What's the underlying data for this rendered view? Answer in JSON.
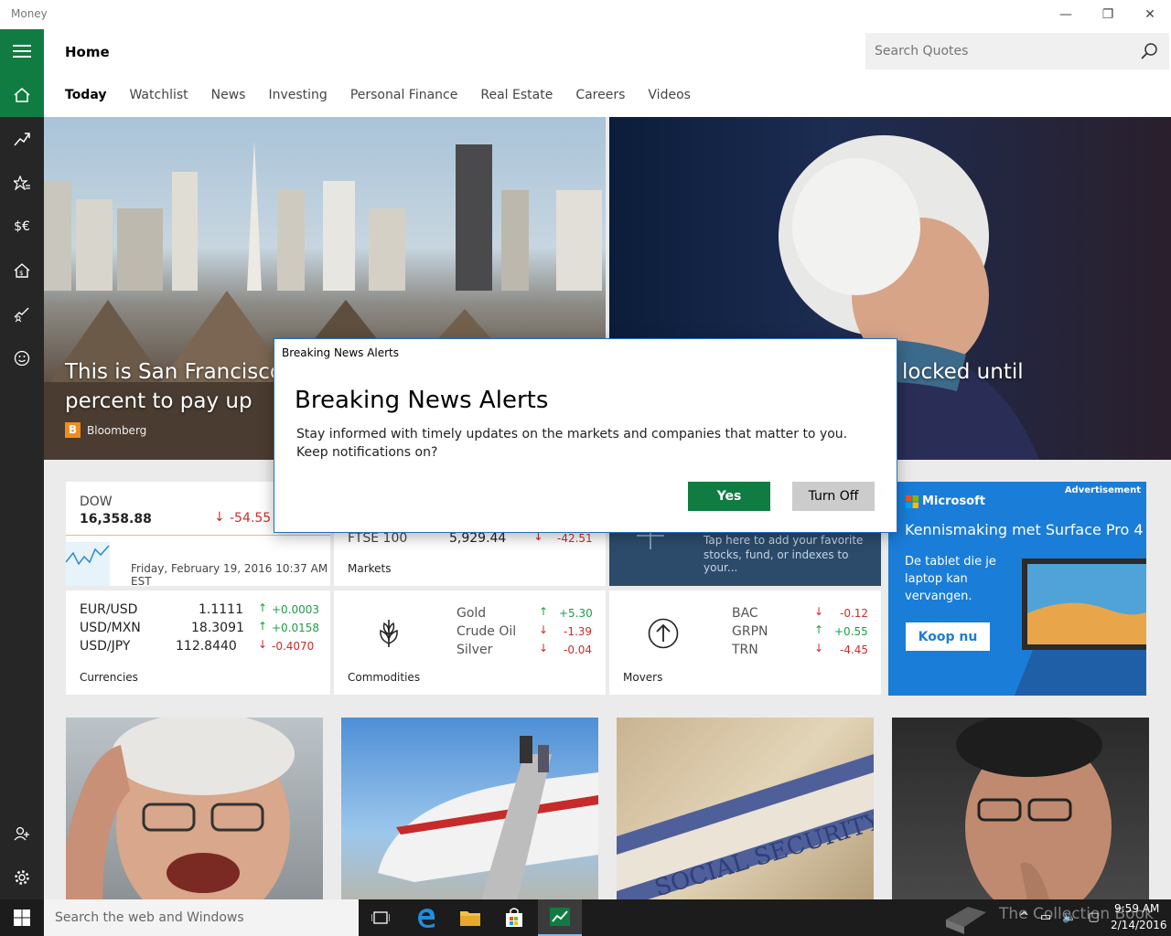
{
  "window": {
    "title": "Money",
    "minimize": "—",
    "restore": "❐",
    "close": "✕"
  },
  "header": {
    "title": "Home",
    "search_placeholder": "Search Quotes"
  },
  "tabs": [
    {
      "label": "Today",
      "active": true
    },
    {
      "label": "Watchlist"
    },
    {
      "label": "News"
    },
    {
      "label": "Investing"
    },
    {
      "label": "Personal Finance"
    },
    {
      "label": "Real Estate"
    },
    {
      "label": "Careers"
    },
    {
      "label": "Videos"
    }
  ],
  "rail": {
    "icons": [
      "hamburger-icon",
      "home-icon",
      "trend-icon",
      "star-list-icon",
      "currency-icon",
      "house-money-icon",
      "chart-person-icon",
      "smiley-icon",
      "add-user-icon",
      "gear-icon"
    ],
    "currency_text": "$€"
  },
  "hero": {
    "left_title_line1": "This is San Francisco's",
    "left_title_line2": "percent to pay up",
    "left_source": "Bloomberg",
    "right_title": "locked until"
  },
  "dow": {
    "name": "DOW",
    "value": "16,358.88",
    "change": "-54.55",
    "date": "Friday, February 19, 2016 10:37 AM EST"
  },
  "markets": {
    "label": "Markets",
    "name": "FTSE 100",
    "value": "5,929.44",
    "change": "-42.51"
  },
  "watchlist_tile": {
    "text_line1": "Tap here to add your favorite",
    "text_line2": "stocks, fund, or indexes to your..."
  },
  "currencies": {
    "label": "Currencies",
    "rows": [
      {
        "name": "EUR/USD",
        "value": "1.1111",
        "change": "+0.0003",
        "dir": "up"
      },
      {
        "name": "USD/MXN",
        "value": "18.3091",
        "change": "+0.0158",
        "dir": "up"
      },
      {
        "name": "USD/JPY",
        "value": "112.8440",
        "change": "-0.4070",
        "dir": "down"
      }
    ]
  },
  "commodities": {
    "label": "Commodities",
    "rows": [
      {
        "name": "Gold",
        "change": "+5.30",
        "dir": "up"
      },
      {
        "name": "Crude Oil",
        "change": "-1.39",
        "dir": "down"
      },
      {
        "name": "Silver",
        "change": "-0.04",
        "dir": "down"
      }
    ]
  },
  "movers": {
    "label": "Movers",
    "rows": [
      {
        "name": "BAC",
        "change": "-0.12",
        "dir": "down"
      },
      {
        "name": "GRPN",
        "change": "+0.55",
        "dir": "up"
      },
      {
        "name": "TRN",
        "change": "-4.45",
        "dir": "down"
      }
    ]
  },
  "ad": {
    "tag": "Advertisement",
    "brand": "Microsoft",
    "headline": "Kennismaking met Surface Pro 4",
    "body_line1": "De tablet die je",
    "body_line2": "laptop kan",
    "body_line3": "vervangen.",
    "cta": "Koop nu"
  },
  "dialog": {
    "window_title": "Breaking News Alerts",
    "heading": "Breaking News Alerts",
    "body_line1": "Stay informed with timely updates on the markets and companies that matter to you.",
    "body_line2": "Keep notifications on?",
    "yes": "Yes",
    "turn_off": "Turn Off"
  },
  "taskbar": {
    "search_placeholder": "Search the web and Windows",
    "time": "9:59 AM",
    "date": "2/14/2016",
    "watermark": "The Collection Book"
  },
  "colors": {
    "accent_green": "#107c41",
    "rail_bg": "#262626",
    "tile_blue": "#2c4b6b",
    "ad_blue": "#1a7dd8"
  }
}
